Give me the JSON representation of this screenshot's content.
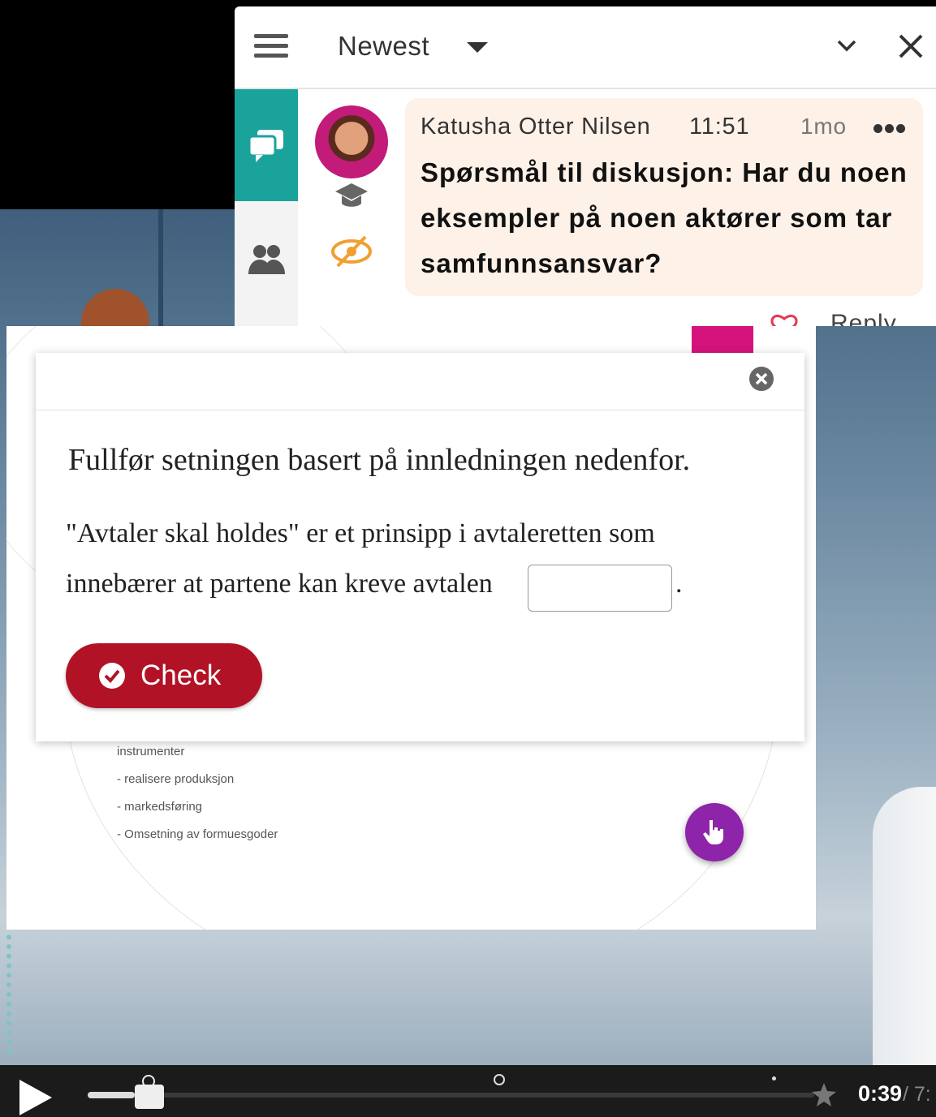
{
  "chat": {
    "sort_label": "Newest",
    "comment": {
      "author": "Katusha Otter Nilsen",
      "time": "11:51",
      "age": "1mo",
      "message": "Spørsmål til diskusjon: Har du noen eksempler på noen aktører som tar samfunnsansvar?"
    },
    "reply_label": "Reply"
  },
  "slide": {
    "lines": [
      "instrumenter",
      "- realisere produksjon",
      "- markedsføring",
      "- Omsetning av formuesgoder"
    ]
  },
  "quiz": {
    "title": "Fullfør setningen basert på innledningen nedenfor.",
    "line1": "\"Avtaler skal holdes\" er et prinsipp i avtaleretten som",
    "line2": "innebærer at partene kan kreve avtalen",
    "period": ".",
    "input_value": "",
    "check_label": "Check"
  },
  "player": {
    "current_time": "0:39",
    "total_time": " / 7:",
    "progress_fraction": 0.065
  },
  "colors": {
    "chat_tab": "#1aa39a",
    "bubble_bg": "#fdf1e8",
    "check_button": "#b11226",
    "hand_button": "#8e24aa",
    "eye_icon": "#f0a030"
  }
}
